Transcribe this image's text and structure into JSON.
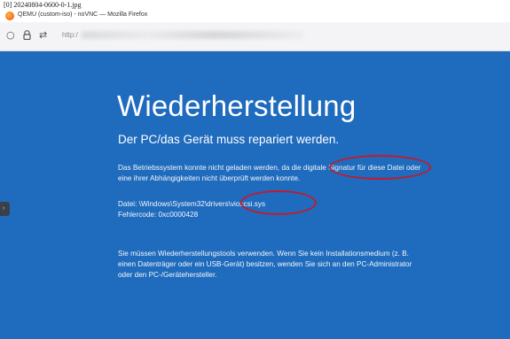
{
  "caption": "[0] 20240804-0600-0-1.jpg",
  "window": {
    "title": "QEMU (custom-iso) - noVNC — Mozilla Firefox",
    "url_prefix": "http:/"
  },
  "recovery": {
    "heading": "Wiederherstellung",
    "subheading": "Der PC/das Gerät muss repariert werden.",
    "para1_line1": "Das Betriebssystem konnte nicht geladen werden, da die digitale Signatur für diese Datei oder",
    "para1_line2": "eine ihrer Abhängigkeiten nicht überprüft werden konnte.",
    "file_line": "Datei: \\Windows\\System32\\drivers\\vioscsi.sys",
    "error_line": "Fehlercode: 0xc0000428",
    "para2_line1": "Sie müssen Wiederherstellungstools verwenden. Wenn Sie kein Installationsmedium (z. B.",
    "para2_line2": "einen Datenträger oder ein USB-Gerät) besitzen, wenden Sie sich an den PC-Administrator",
    "para2_line3": "oder den PC-/Gerätehersteller."
  },
  "colors": {
    "screen_background": "#1f6bbd",
    "annotation": "#c41a2c"
  },
  "icons": [
    "firefox-logo-icon",
    "back-icon",
    "lock-icon",
    "permissions-icon",
    "sidebar-toggle-icon"
  ]
}
